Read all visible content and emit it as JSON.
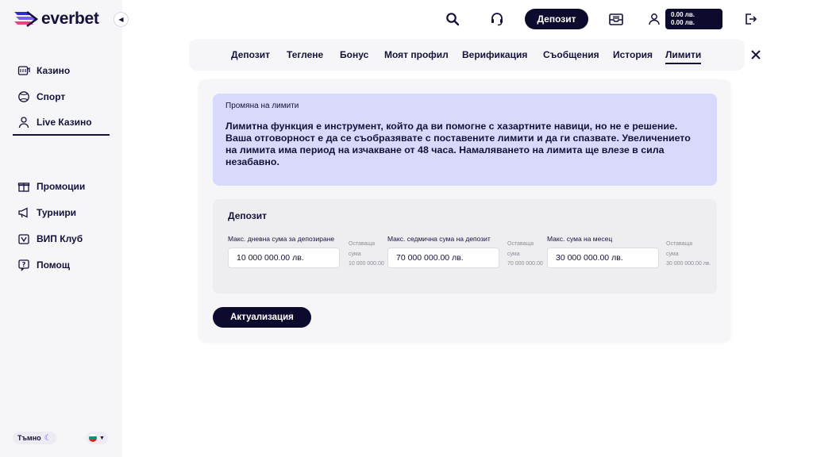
{
  "brand": {
    "name": "everbet"
  },
  "sidebar": {
    "items_top": [
      {
        "label": "Казино",
        "icon": "casino-icon"
      },
      {
        "label": "Спорт",
        "icon": "sport-icon"
      },
      {
        "label": "Live Казино",
        "icon": "live-casino-icon"
      }
    ],
    "items_bottom": [
      {
        "label": "Промоции",
        "icon": "gift-icon"
      },
      {
        "label": "Турнири",
        "icon": "megaphone-icon"
      },
      {
        "label": "ВИП Клуб",
        "icon": "vip-icon"
      },
      {
        "label": "Помощ",
        "icon": "help-icon"
      }
    ],
    "theme_label": "Тъмно",
    "language_flag": "bulgaria-flag"
  },
  "header": {
    "deposit_label": "Депозит",
    "balance_line1": "0.00 лв.",
    "balance_line2": "0.00 лв."
  },
  "tabs": [
    {
      "label": "Депозит"
    },
    {
      "label": "Теглене"
    },
    {
      "label": "Бонус"
    },
    {
      "label": "Моят профил"
    },
    {
      "label": "Верификация"
    },
    {
      "label": "Съобщения"
    },
    {
      "label": "История"
    },
    {
      "label": "Лимити",
      "active": true
    }
  ],
  "info": {
    "title": "Промяна на лимити",
    "text": "Лимитна функция е инструмент, който да ви помогне с хазартните навици, но не е решение. Ваша отговорност е да се съобразявате с поставените лимити и да ги спазвате. Увеличението на лимита има период на изчакване от 48 часа. Намаляването на лимита ще влезе в сила незабавно."
  },
  "limits": {
    "title": "Депозит",
    "fields": [
      {
        "label": "Макс. дневна сума за депозиране",
        "value": "10 000 000.00 лв.",
        "remaining_label_1": "Оставаща",
        "remaining_label_2": "сума",
        "remaining_value": "10 000 000.00"
      },
      {
        "label": "Макс. седмична сума на депозит",
        "value": "70 000 000.00 лв.",
        "remaining_label_1": "Оставаща",
        "remaining_label_2": "сума",
        "remaining_value": "70 000 000.00"
      },
      {
        "label": "Макс. сума на месец",
        "value": "30 000 000.00 лв.",
        "remaining_label_1": "Оставаща",
        "remaining_label_2": "сума",
        "remaining_value": "30 000 000.00 лв."
      }
    ]
  },
  "update_label": "Актуализация",
  "colors": {
    "primary": "#0c0b2e",
    "info_bg": "#d9d9fb",
    "sidebar_bg": "#f6f6f8"
  }
}
